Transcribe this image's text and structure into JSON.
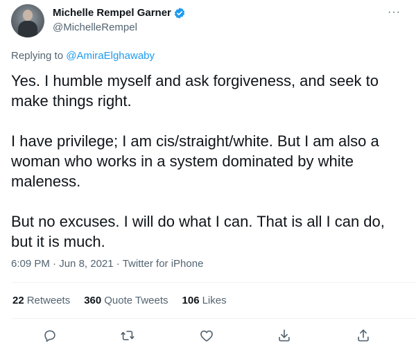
{
  "user": {
    "display_name": "Michelle Rempel Garner",
    "handle": "@MichelleRempel"
  },
  "more_label": "···",
  "reply": {
    "prefix": "Replying to ",
    "target": "@AmiraElghawaby"
  },
  "tweet": {
    "text": "Yes. I humble myself and ask forgiveness, and seek to make things right.\n\nI have privilege; I am cis/straight/white. But I am also a woman who works in a system dominated by white maleness.\n\nBut no excuses. I will do what I can. That is all I can do, but it is much."
  },
  "meta": {
    "time": "6:09 PM",
    "sep1": " · ",
    "date": "Jun 8, 2021",
    "sep2": " · ",
    "source": "Twitter for iPhone"
  },
  "stats": {
    "retweets": {
      "count": "22",
      "label": "Retweets"
    },
    "quotes": {
      "count": "360",
      "label": "Quote Tweets"
    },
    "likes": {
      "count": "106",
      "label": "Likes"
    }
  },
  "icons": [
    "verified-badge-icon",
    "reply-icon",
    "retweet-icon",
    "like-icon",
    "bookmark-icon",
    "share-icon"
  ],
  "colors": {
    "accent": "#1d9bf0",
    "text": "#0f1419",
    "muted": "#536471",
    "divider": "#eff3f4"
  }
}
